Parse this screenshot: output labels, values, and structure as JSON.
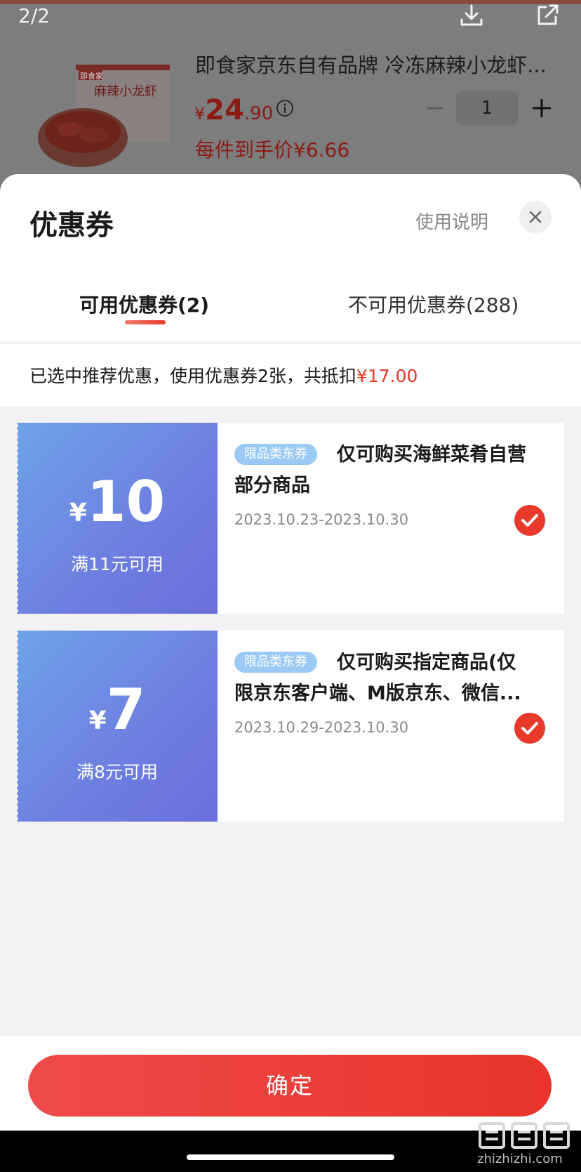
{
  "header": {
    "page_indicator": "2/2",
    "product_title": "即食家京东自有品牌 冷冻麻辣小龙虾...",
    "price_currency": "¥",
    "price_integer": "24",
    "price_decimal": ".90",
    "quantity": "1",
    "unit_price": "每件到手价¥6.66",
    "product_image_text": "麻辣小龙虾",
    "product_brand_text": "即食家"
  },
  "sheet": {
    "title": "优惠券",
    "help_label": "使用说明",
    "tabs": [
      {
        "label": "可用优惠券(2)",
        "active": true
      },
      {
        "label": "不可用优惠券(288)",
        "active": false
      }
    ],
    "summary_prefix": "已选中推荐优惠，使用优惠券2张，共抵扣",
    "summary_amount": "¥17.00"
  },
  "coupons": [
    {
      "currency": "¥",
      "amount": "10",
      "threshold": "满11元可用",
      "badge": "限品类东券",
      "description": "仅可购买海鲜菜肴自营部分商品",
      "validity": "2023.10.23-2023.10.30",
      "selected": true
    },
    {
      "currency": "¥",
      "amount": "7",
      "threshold": "满8元可用",
      "badge": "限品类东券",
      "description": "仅可购买指定商品(仅限京东客户端、M版京东、微信...",
      "validity": "2023.10.29-2023.10.30",
      "selected": true
    }
  ],
  "footer": {
    "confirm_label": "确定",
    "watermark": "zhizhizhi.com"
  },
  "colors": {
    "accent_red": "#e8392a",
    "coupon_blue": "#6d7ee0",
    "badge_blue": "#9ccaf5"
  }
}
